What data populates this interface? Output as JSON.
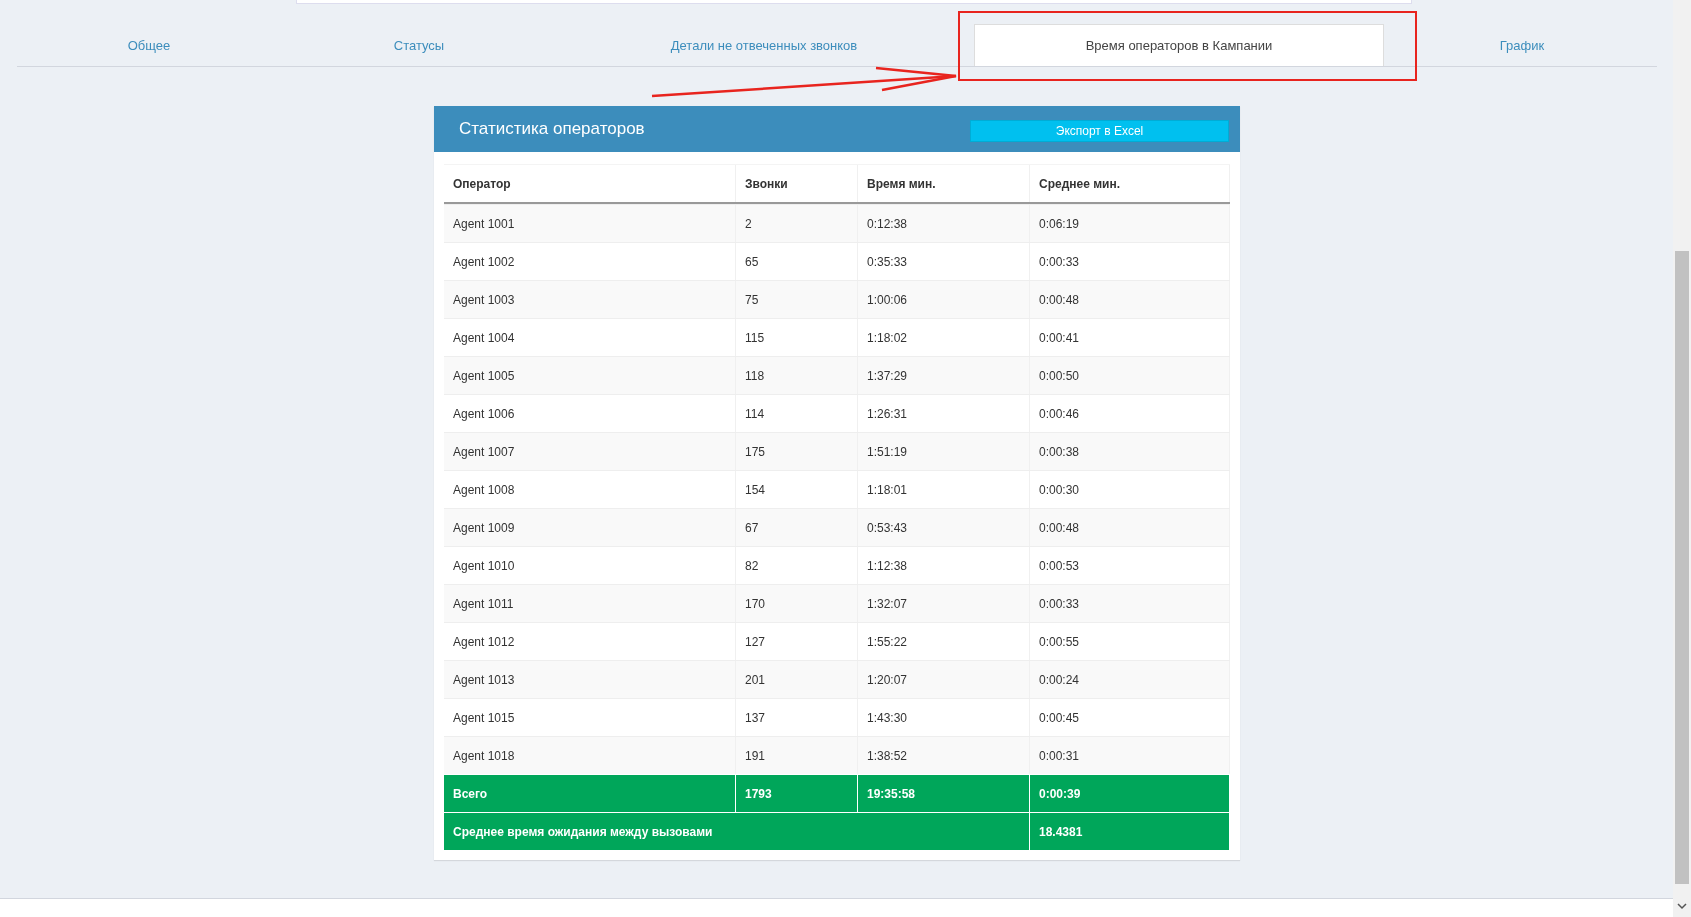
{
  "tabs": [
    {
      "label": "Общее",
      "selected": false
    },
    {
      "label": "Статусы",
      "selected": false
    },
    {
      "label": "Детали не отвеченных звонков",
      "selected": false
    },
    {
      "label": "Время операторов в Кампании",
      "selected": true
    },
    {
      "label": "График",
      "selected": false
    }
  ],
  "panel": {
    "title": "Статистика операторов",
    "export_button": "Экспорт в Excel"
  },
  "table": {
    "columns": [
      "Оператор",
      "Звонки",
      "Время мин.",
      "Среднее мин."
    ],
    "rows": [
      [
        "Agent 1001",
        "2",
        "0:12:38",
        "0:06:19"
      ],
      [
        "Agent 1002",
        "65",
        "0:35:33",
        "0:00:33"
      ],
      [
        "Agent 1003",
        "75",
        "1:00:06",
        "0:00:48"
      ],
      [
        "Agent 1004",
        "115",
        "1:18:02",
        "0:00:41"
      ],
      [
        "Agent 1005",
        "118",
        "1:37:29",
        "0:00:50"
      ],
      [
        "Agent 1006",
        "114",
        "1:26:31",
        "0:00:46"
      ],
      [
        "Agent 1007",
        "175",
        "1:51:19",
        "0:00:38"
      ],
      [
        "Agent 1008",
        "154",
        "1:18:01",
        "0:00:30"
      ],
      [
        "Agent 1009",
        "67",
        "0:53:43",
        "0:00:48"
      ],
      [
        "Agent 1010",
        "82",
        "1:12:38",
        "0:00:53"
      ],
      [
        "Agent 1011",
        "170",
        "1:32:07",
        "0:00:33"
      ],
      [
        "Agent 1012",
        "127",
        "1:55:22",
        "0:00:55"
      ],
      [
        "Agent 1013",
        "201",
        "1:20:07",
        "0:00:24"
      ],
      [
        "Agent 1015",
        "137",
        "1:43:30",
        "0:00:45"
      ],
      [
        "Agent 1018",
        "191",
        "1:38:52",
        "0:00:31"
      ]
    ],
    "total_row": [
      "Всего",
      "1793",
      "19:35:58",
      "0:00:39"
    ],
    "average_wait_row": {
      "label": "Среднее время ожидания между вызовами",
      "value": "18.4381"
    }
  }
}
